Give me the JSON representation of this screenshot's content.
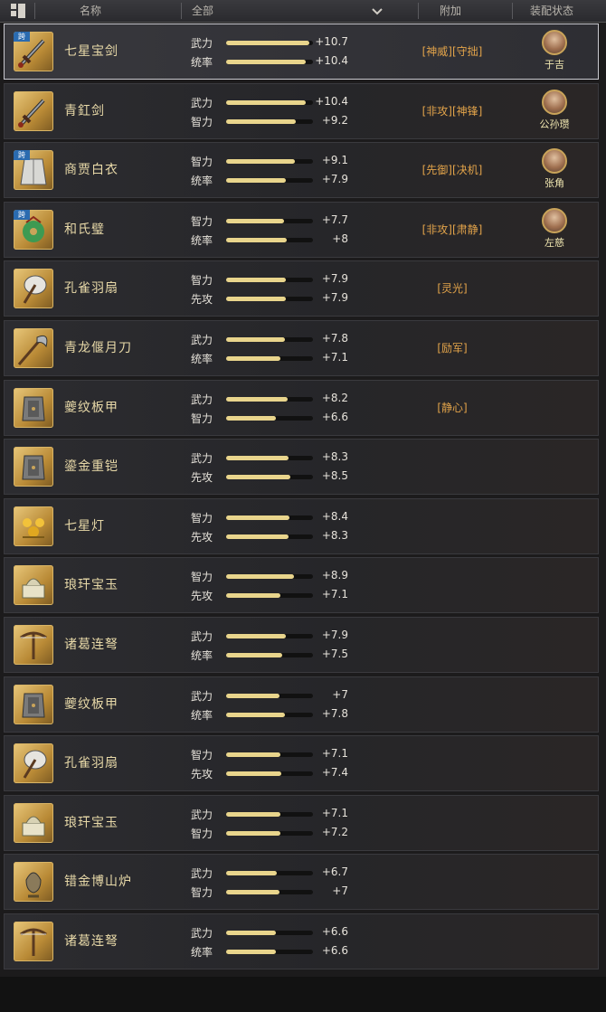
{
  "header": {
    "name_col": "名称",
    "filter_value": "全部",
    "bonus_col": "附加",
    "equip_status_col": "装配状态"
  },
  "items": [
    {
      "name": "七星宝剑",
      "icon": "sword-icon",
      "cross_server": true,
      "cross_label": "跨",
      "stats": [
        {
          "label": "武力",
          "value": "+10.7",
          "fill": 0.96
        },
        {
          "label": "统率",
          "value": "+10.4",
          "fill": 0.92
        }
      ],
      "skills": "[神威][守拙]",
      "general": "于吉",
      "selected": true
    },
    {
      "name": "青釭剑",
      "icon": "sword-icon",
      "cross_server": false,
      "stats": [
        {
          "label": "武力",
          "value": "+10.4",
          "fill": 0.92
        },
        {
          "label": "智力",
          "value": "+9.2",
          "fill": 0.8
        }
      ],
      "skills": "[非攻][神锋]",
      "general": "公孙瓒"
    },
    {
      "name": "商贾白衣",
      "icon": "robe-icon",
      "cross_server": true,
      "cross_label": "跨",
      "stats": [
        {
          "label": "智力",
          "value": "+9.1",
          "fill": 0.79
        },
        {
          "label": "统率",
          "value": "+7.9",
          "fill": 0.69
        }
      ],
      "skills": "[先御][决机]",
      "general": "张角"
    },
    {
      "name": "和氏璧",
      "icon": "jade-disc-icon",
      "cross_server": true,
      "cross_label": "跨",
      "stats": [
        {
          "label": "智力",
          "value": "+7.7",
          "fill": 0.67
        },
        {
          "label": "统率",
          "value": "+8",
          "fill": 0.7
        }
      ],
      "skills": "[非攻][肃静]",
      "general": "左慈"
    },
    {
      "name": "孔雀羽扇",
      "icon": "feather-fan-icon",
      "cross_server": false,
      "stats": [
        {
          "label": "智力",
          "value": "+7.9",
          "fill": 0.69
        },
        {
          "label": "先攻",
          "value": "+7.9",
          "fill": 0.69
        }
      ],
      "skills": "[灵光]",
      "general": ""
    },
    {
      "name": "青龙偃月刀",
      "icon": "glaive-icon",
      "cross_server": false,
      "stats": [
        {
          "label": "武力",
          "value": "+7.8",
          "fill": 0.68
        },
        {
          "label": "统率",
          "value": "+7.1",
          "fill": 0.62
        }
      ],
      "skills": "[励军]",
      "general": ""
    },
    {
      "name": "夔纹板甲",
      "icon": "armor-icon",
      "cross_server": false,
      "stats": [
        {
          "label": "武力",
          "value": "+8.2",
          "fill": 0.71
        },
        {
          "label": "智力",
          "value": "+6.6",
          "fill": 0.57
        }
      ],
      "skills": "[静心]",
      "general": ""
    },
    {
      "name": "鎏金重铠",
      "icon": "armor-icon",
      "cross_server": false,
      "stats": [
        {
          "label": "武力",
          "value": "+8.3",
          "fill": 0.72
        },
        {
          "label": "先攻",
          "value": "+8.5",
          "fill": 0.74
        }
      ],
      "skills": "",
      "general": ""
    },
    {
      "name": "七星灯",
      "icon": "lamp-icon",
      "cross_server": false,
      "stats": [
        {
          "label": "智力",
          "value": "+8.4",
          "fill": 0.73
        },
        {
          "label": "先攻",
          "value": "+8.3",
          "fill": 0.72
        }
      ],
      "skills": "",
      "general": ""
    },
    {
      "name": "琅玕宝玉",
      "icon": "jade-seal-icon",
      "cross_server": false,
      "stats": [
        {
          "label": "智力",
          "value": "+8.9",
          "fill": 0.78
        },
        {
          "label": "先攻",
          "value": "+7.1",
          "fill": 0.62
        }
      ],
      "skills": "",
      "general": ""
    },
    {
      "name": "诸葛连弩",
      "icon": "crossbow-icon",
      "cross_server": false,
      "stats": [
        {
          "label": "武力",
          "value": "+7.9",
          "fill": 0.69
        },
        {
          "label": "统率",
          "value": "+7.5",
          "fill": 0.65
        }
      ],
      "skills": "",
      "general": ""
    },
    {
      "name": "夔纹板甲",
      "icon": "armor-icon",
      "cross_server": false,
      "stats": [
        {
          "label": "武力",
          "value": "+7",
          "fill": 0.61
        },
        {
          "label": "统率",
          "value": "+7.8",
          "fill": 0.68
        }
      ],
      "skills": "",
      "general": ""
    },
    {
      "name": "孔雀羽扇",
      "icon": "feather-fan-icon",
      "cross_server": false,
      "stats": [
        {
          "label": "智力",
          "value": "+7.1",
          "fill": 0.62
        },
        {
          "label": "先攻",
          "value": "+7.4",
          "fill": 0.64
        }
      ],
      "skills": "",
      "general": ""
    },
    {
      "name": "琅玕宝玉",
      "icon": "jade-seal-icon",
      "cross_server": false,
      "stats": [
        {
          "label": "武力",
          "value": "+7.1",
          "fill": 0.62
        },
        {
          "label": "智力",
          "value": "+7.2",
          "fill": 0.63
        }
      ],
      "skills": "",
      "general": ""
    },
    {
      "name": "错金博山炉",
      "icon": "incense-burner-icon",
      "cross_server": false,
      "stats": [
        {
          "label": "武力",
          "value": "+6.7",
          "fill": 0.58
        },
        {
          "label": "智力",
          "value": "+7",
          "fill": 0.61
        }
      ],
      "skills": "",
      "general": ""
    },
    {
      "name": "诸葛连弩",
      "icon": "crossbow-icon",
      "cross_server": false,
      "stats": [
        {
          "label": "武力",
          "value": "+6.6",
          "fill": 0.57
        },
        {
          "label": "统率",
          "value": "+6.6",
          "fill": 0.57
        }
      ],
      "skills": "",
      "general": ""
    }
  ],
  "colors": {
    "skill_text": "#e2a34a",
    "bar_fill": "#e9d58c",
    "item_name": "#e8d9a8",
    "cross_badge": "#2a6bb0"
  }
}
